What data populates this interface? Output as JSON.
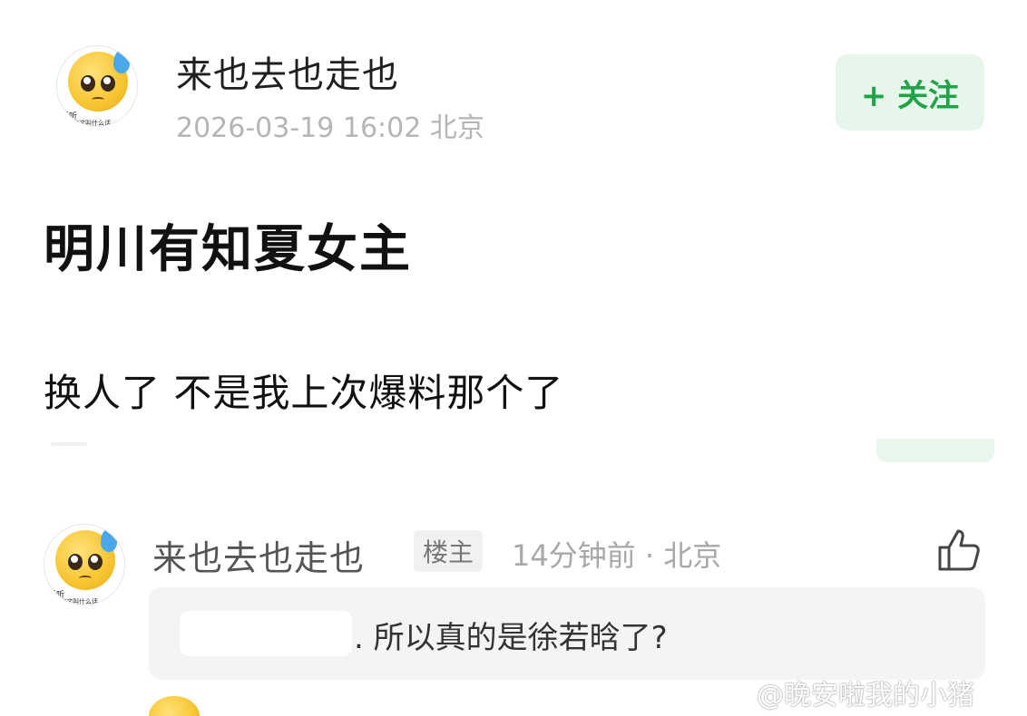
{
  "post": {
    "username": "来也去也走也",
    "timestamp": "2026-03-19 16:02",
    "location": "北京",
    "meta": "2026-03-19 16:02  北京",
    "follow_label": "+ 关注",
    "title": "明川有知夏女主",
    "body": "换人了 不是我上次爆料那个了",
    "avatar_caption_top": "听听",
    "avatar_caption_bottom": "说的这叫什么话"
  },
  "comment": {
    "username": "来也去也走也",
    "badge": "楼主",
    "meta": "14分钟前 · 北京",
    "quote_text": ". 所以真的是徐若晗了?",
    "avatar_caption_top": "听听",
    "avatar_caption_bottom": "说的这叫什么话"
  },
  "watermark": {
    "text": "@晚安啦我的小猪"
  },
  "colors": {
    "accent_green": "#22a34a",
    "follow_bg": "#e6f6ea",
    "meta_gray": "#b5b5b5"
  },
  "icons": {
    "like": "thumbs-up-icon",
    "avatar": "pleading-face-sweat-emoji"
  }
}
